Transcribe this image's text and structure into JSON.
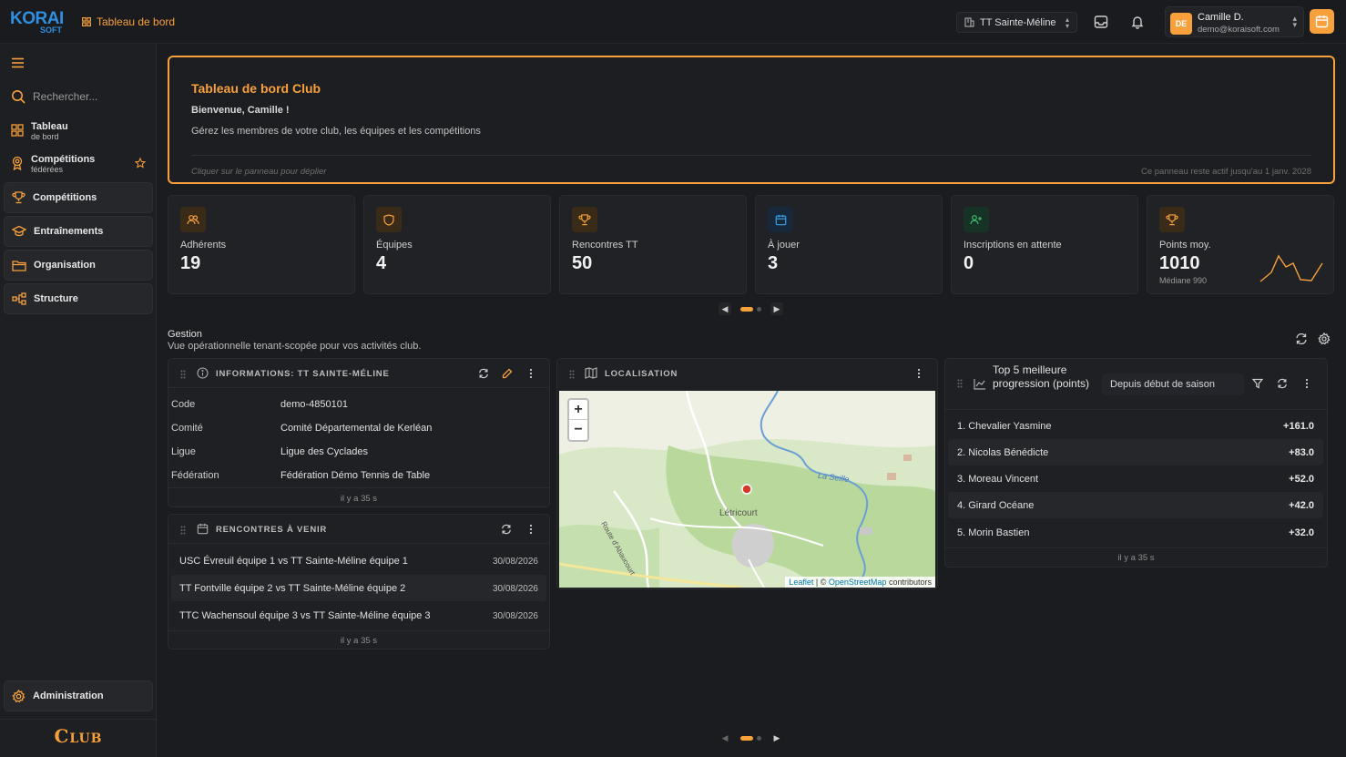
{
  "app": {
    "logo_main": "KORAI",
    "logo_sub": "SOFT",
    "breadcrumb": "Tableau de bord",
    "tenant": "TT Sainte-Méline",
    "user": {
      "initials": "DE",
      "name": "Camille D.",
      "email": "demo@koraisoft.com"
    },
    "accent": "#f7a03c"
  },
  "sidebar": {
    "search_placeholder": "Rechercher...",
    "items": [
      {
        "label": "Tableau",
        "sub": "de bord",
        "icon": "grid-icon"
      },
      {
        "label": "Compétitions",
        "sub": "fédérées",
        "icon": "medal-icon"
      },
      {
        "label": "Compétitions",
        "icon": "trophy-icon"
      },
      {
        "label": "Entraînements",
        "icon": "graduation-cap-icon"
      },
      {
        "label": "Organisation",
        "icon": "folder-icon"
      },
      {
        "label": "Structure",
        "icon": "hierarchy-icon"
      }
    ],
    "admin_label": "Administration",
    "brand": "Club"
  },
  "banner": {
    "title": "Tableau de bord Club",
    "greeting": "Bienvenue, Camille !",
    "description": "Gérez les membres de votre club, les équipes et les compétitions",
    "hint": "Cliquer sur le panneau pour déplier",
    "validity": "Ce panneau reste actif jusqu'au 1 janv. 2028"
  },
  "stats": [
    {
      "label": "Adhérents",
      "value": "19",
      "icon": "users-icon",
      "color": "#f7a03c"
    },
    {
      "label": "Équipes",
      "value": "4",
      "icon": "shield-icon",
      "color": "#f7a03c"
    },
    {
      "label": "Rencontres TT",
      "value": "50",
      "icon": "trophy-icon",
      "color": "#f7a03c"
    },
    {
      "label": "À jouer",
      "value": "3",
      "icon": "calendar-icon",
      "color": "#3b9ce0"
    },
    {
      "label": "Inscriptions en attente",
      "value": "0",
      "icon": "user-plus-icon",
      "color": "#3fbf6f"
    },
    {
      "label": "Points moy.",
      "value": "1010",
      "sub": "Médiane 990",
      "icon": "trophy-icon",
      "color": "#f7a03c"
    }
  ],
  "section": {
    "title": "Gestion",
    "subtitle": "Vue opérationnelle tenant-scopée pour vos activités club."
  },
  "info_panel": {
    "title": "INFORMATIONS: TT SAINTE-MÉLINE",
    "rows": [
      {
        "k": "Code",
        "v": "demo-4850101"
      },
      {
        "k": "Comité",
        "v": "Comité Départemental de Kerléan"
      },
      {
        "k": "Ligue",
        "v": "Ligue des Cyclades"
      },
      {
        "k": "Fédération",
        "v": "Fédération Démo Tennis de Table"
      }
    ],
    "updated": "il y a 35 s"
  },
  "matches_panel": {
    "title": "RENCONTRES À VENIR",
    "rows": [
      {
        "t": "USC Évreuil équipe 1 vs TT Sainte-Méline équipe 1",
        "d": "30/08/2026"
      },
      {
        "t": "TT Fontville équipe 2 vs TT Sainte-Méline équipe 2",
        "d": "30/08/2026"
      },
      {
        "t": "TTC Wachensoul équipe 3 vs TT Sainte-Méline équipe 3",
        "d": "30/08/2026"
      }
    ],
    "updated": "il y a 35 s"
  },
  "map_panel": {
    "title": "LOCALISATION",
    "town": "Létricourt",
    "river": "La Seille",
    "road": "Route d'Abaucourt",
    "zoom_in": "+",
    "zoom_out": "−",
    "attrib_leaflet": "Leaflet",
    "attrib_sep": "| ©",
    "attrib_osm": "OpenStreetMap",
    "attrib_contrib": "contributors"
  },
  "top_panel": {
    "title": "Top 5 meilleure progression (points)",
    "period": "Depuis début de saison",
    "rows": [
      {
        "n": "1. Chevalier Yasmine",
        "v": "+161.0"
      },
      {
        "n": "2. Nicolas Bénédicte",
        "v": "+83.0"
      },
      {
        "n": "3. Moreau Vincent",
        "v": "+52.0"
      },
      {
        "n": "4. Girard Océane",
        "v": "+42.0"
      },
      {
        "n": "5. Morin Bastien",
        "v": "+32.0"
      }
    ],
    "updated": "il y a 35 s"
  }
}
